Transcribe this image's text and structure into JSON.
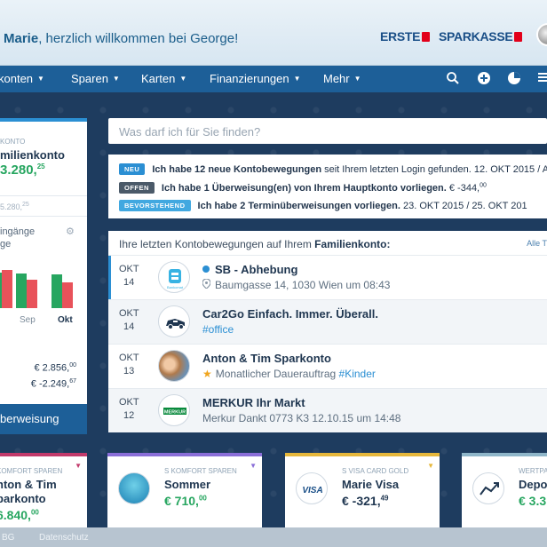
{
  "header": {
    "greeting_name": "Marie",
    "greeting_rest": ", herzlich willkommen bei George!",
    "logo_erste": "ERSTE",
    "logo_sparkasse": "SPARKASSE"
  },
  "nav": {
    "items": [
      "konten",
      "Sparen",
      "Karten",
      "Finanzierungen",
      "Mehr"
    ],
    "icons": [
      "search-icon",
      "plus-icon",
      "chart-icon",
      "menu-icon"
    ]
  },
  "account": {
    "type": "KONTO",
    "name": "milienkonto",
    "balance": "3.280,",
    "balance_cents": "25",
    "sub": "5.280,",
    "sub_cents": "25",
    "income_l1": "ingänge",
    "income_l2": "ge",
    "month1": "Sep",
    "month2": "Okt",
    "amount1": "€ 2.856,",
    "amount1_cents": "00",
    "amount2": "€ -2.249,",
    "amount2_cents": "67",
    "transfer_label": "berweisung",
    "bars": {
      "income": [
        0.8,
        0.78,
        0.76
      ],
      "expense": [
        0.85,
        0.64,
        0.58
      ],
      "colors": {
        "income": "#27a660",
        "expense": "#e8525a"
      }
    }
  },
  "search": {
    "placeholder": "Was darf ich für Sie finden?"
  },
  "notifications": [
    {
      "badge": "NEU",
      "badge_color": "#2b8fd3",
      "bold": "Ich habe 12 neue Kontobewegungen",
      "rest": " seit Ihrem letzten Login gefunden. 12. OKT 2015 / A"
    },
    {
      "badge": "OFFEN",
      "badge_color": "#4b5a69",
      "bold": "Ich habe 1 Überweisung(en) von Ihrem Hauptkonto vorliegen.",
      "rest": " € -344,",
      "rest_cents": "00"
    },
    {
      "badge": "BEVORSTEHEND",
      "badge_color": "#41a8e0",
      "bold": "Ich habe 2 Terminüberweisungen vorliegen.",
      "rest": " 23. OKT 2015 / 25. OKT 201"
    }
  ],
  "transactions": {
    "heading_pre": "Ihre letzten Kontobewegungen auf Ihrem ",
    "heading_account": "Familienkonto:",
    "all_label": "Alle T",
    "rows": [
      {
        "month": "OKT",
        "day": "14",
        "title": "SB - Abhebung",
        "subtitle": "Baumgasse 14, 1030 Wien um 08:43",
        "tag": "",
        "icon": "bankomat-icon"
      },
      {
        "month": "OKT",
        "day": "14",
        "title": "Car2Go Einfach. Immer. Überall.",
        "subtitle": "",
        "tag": "#office",
        "icon": "car-icon"
      },
      {
        "month": "OKT",
        "day": "13",
        "title": "Anton & Tim Sparkonto",
        "subtitle": "Monatlicher Dauerauftrag ",
        "tag": "#Kinder",
        "icon": "photo-icon"
      },
      {
        "month": "OKT",
        "day": "12",
        "title": "MERKUR Ihr Markt",
        "subtitle": "Merkur Dankt 0773 K3 12.10.15 um 14:48",
        "tag": "",
        "icon": "merkur-logo-icon"
      }
    ]
  },
  "tiles": [
    {
      "label": "KOMFORT SPAREN",
      "name1": "nton & Tim",
      "name2": "parkonto",
      "amount": "6.840,",
      "cents": "00",
      "color": "#c23a6b"
    },
    {
      "label": "S KOMFORT SPAREN",
      "name1": "Sommer",
      "amount": "€ 710,",
      "cents": "00",
      "color": "#8a6ed8"
    },
    {
      "label": "S VISA CARD GOLD",
      "name1": "Marie Visa",
      "amount": "€ -321,",
      "cents": "49",
      "color": "#e6b73b"
    },
    {
      "label": "WERTPAPIERE",
      "name1": "Depot",
      "amount": "€ 3.3",
      "cents": "",
      "color": "#8fb6c9"
    }
  ],
  "footer": {
    "link1": "BG",
    "link2": "Datenschutz"
  }
}
